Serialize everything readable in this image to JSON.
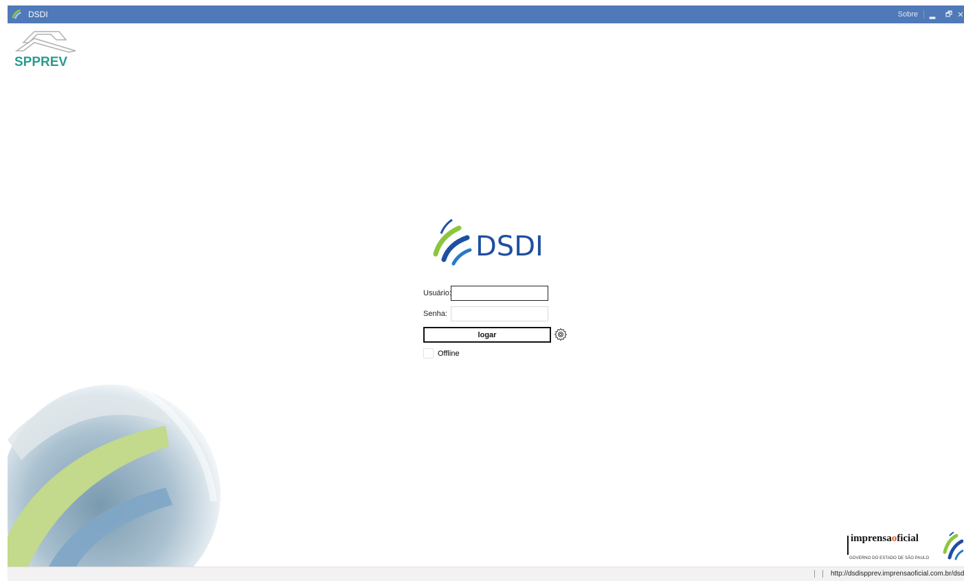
{
  "window": {
    "title": "DSDI",
    "about_label": "Sobre",
    "minimize_glyph": "▂",
    "restore_glyph": "🗗"
  },
  "branding": {
    "top_left_logo_text": "SPPREV",
    "center_logo_text": "DSDI",
    "footer_brand_prefix": "imprensa",
    "footer_brand_highlight": "o",
    "footer_brand_suffix": "ficial",
    "footer_brand_subtitle": "GOVERNO DO ESTADO DE SÃO PAULO"
  },
  "login": {
    "username_label": "Usuário:",
    "username_value": "",
    "password_label": "Senha:",
    "password_value": "",
    "submit_label": "logar",
    "offline_label": "Offline",
    "offline_checked": false
  },
  "status": {
    "url": "http://dsdispprev.imprensaoficial.com.br/dsdi-a"
  },
  "colors": {
    "titlebar": "#4f79b8",
    "spprev_teal": "#2a9a8f",
    "dsdi_blue": "#1e4fa0",
    "accent_green": "#8cc63f",
    "footer_orange": "#e0501e"
  },
  "icons": {
    "app": "dsdi-swoosh-icon",
    "settings": "gear-icon",
    "globe": "globe-illustration"
  }
}
